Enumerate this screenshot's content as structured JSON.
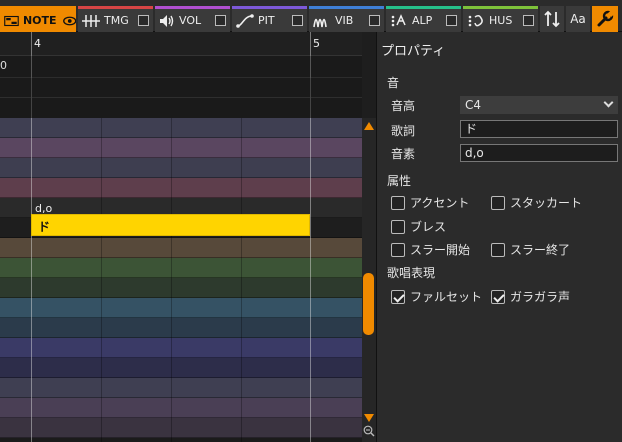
{
  "tabs": [
    {
      "id": "note",
      "label": "NOTE",
      "icon": "note-grid-icon",
      "accent": "#f08a00",
      "active": true
    },
    {
      "id": "tmg",
      "label": "TMG",
      "icon": "timing-lines-icon",
      "accent": "#d64545",
      "active": false
    },
    {
      "id": "vol",
      "label": "VOL",
      "icon": "speaker-icon",
      "accent": "#b04fd0",
      "active": false
    },
    {
      "id": "pit",
      "label": "PIT",
      "icon": "pitch-curve-icon",
      "accent": "#7d59d8",
      "active": false
    },
    {
      "id": "vib",
      "label": "VIB",
      "icon": "vibrato-icon",
      "accent": "#3f7fd6",
      "active": false
    },
    {
      "id": "alp",
      "label": "ALP",
      "icon": "alpha-icon",
      "accent": "#26c08a",
      "active": false
    },
    {
      "id": "hus",
      "label": "HUS",
      "icon": "husky-icon",
      "accent": "#7ec23a",
      "active": false
    }
  ],
  "toolbar": {
    "sort_icon": "sort-arrows-icon",
    "font_button_label": "Aa",
    "settings_icon": "wrench-icon"
  },
  "timeline": {
    "measures": [
      {
        "label": "4"
      },
      {
        "label": "5"
      }
    ],
    "tempo_label": "0"
  },
  "note": {
    "lyric": "ド",
    "phoneme": "d,o",
    "color": "#ffd400"
  },
  "panel": {
    "title": "プロパティ",
    "section_sound": "音",
    "pitch_label": "音高",
    "pitch_value": "C4",
    "lyric_label": "歌詞",
    "lyric_value": "ド",
    "phoneme_label": "音素",
    "phoneme_value": "d,o",
    "section_attributes": "属性",
    "attributes": [
      {
        "label": "アクセント",
        "checked": false
      },
      {
        "label": "スタッカート",
        "checked": false
      },
      {
        "label": "ブレス",
        "checked": false
      },
      {
        "label": "スラー開始",
        "checked": false
      },
      {
        "label": "スラー終了",
        "checked": false
      }
    ],
    "section_expression": "歌唱表現",
    "expressions": [
      {
        "label": "ファルセット",
        "checked": true
      },
      {
        "label": "ガラガラ声",
        "checked": true
      }
    ]
  },
  "colors": {
    "accent": "#f08a00",
    "panel_bg": "#2b2b2b",
    "note": "#ffd400"
  }
}
